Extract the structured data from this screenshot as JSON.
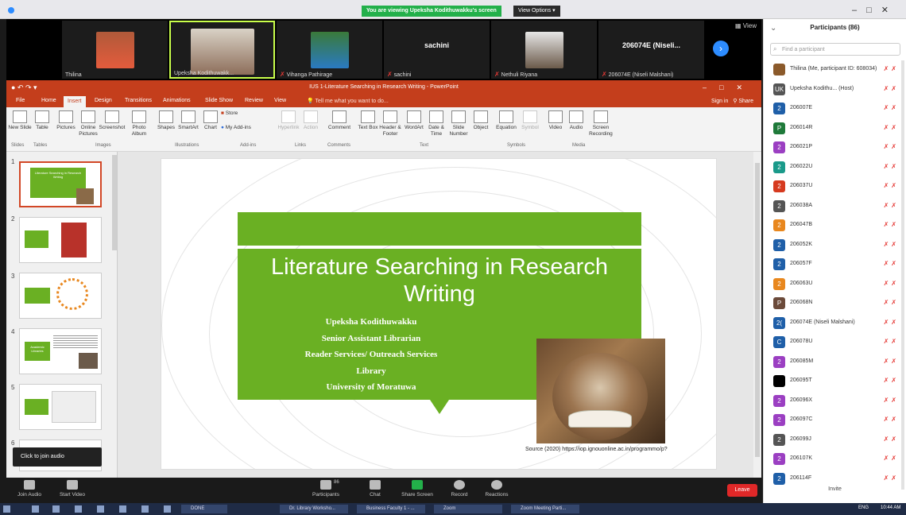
{
  "window": {
    "sharing_banner": "You are viewing Upeksha Kodithuwakku's screen",
    "view_options": "View Options"
  },
  "video": {
    "view_label": "View",
    "tiles": [
      {
        "name": "Thilina",
        "type": "video",
        "mic_muted": false
      },
      {
        "name": "Upeksha Kodithuwakk...",
        "type": "video",
        "mic_muted": false,
        "active_speaker": true
      },
      {
        "name": "Vihanga Pathirage",
        "type": "video",
        "mic_muted": true
      },
      {
        "name": "sachini",
        "center": "sachini",
        "type": "name",
        "mic_muted": true
      },
      {
        "name": "Nethuli Riyana",
        "type": "video",
        "mic_muted": true
      },
      {
        "name": "206074E (Niseli Malshani)",
        "center": "206074E (Niseli...",
        "type": "name",
        "mic_muted": true
      }
    ]
  },
  "ppt": {
    "doc_title": "IUS 1-Literature Searching in Research Writing - PowerPoint",
    "tell_me": "Tell me what you want to do...",
    "sign_in": "Sign in",
    "share": "Share",
    "menus": [
      "File",
      "Home",
      "Insert",
      "Design",
      "Transitions",
      "Animations",
      "Slide Show",
      "Review",
      "View"
    ],
    "active_menu": "Insert",
    "ribbon": {
      "buttons": [
        "New Slide",
        "Table",
        "Pictures",
        "Online Pictures",
        "Screenshot",
        "Photo Album",
        "Shapes",
        "SmartArt",
        "Chart",
        "Store",
        "My Add-ins",
        "Hyperlink",
        "Action",
        "Comment",
        "Text Box",
        "Header & Footer",
        "WordArt",
        "Date & Time",
        "Slide Number",
        "Object",
        "Equation",
        "Symbol",
        "Video",
        "Audio",
        "Screen Recording"
      ],
      "groups": [
        "Slides",
        "Tables",
        "Images",
        "Illustrations",
        "Add-ins",
        "Links",
        "Comments",
        "Text",
        "Symbols",
        "Media"
      ]
    },
    "thumb_numbers": [
      "1",
      "2",
      "3",
      "4",
      "5",
      "6"
    ],
    "thumb_titles": [
      "Literature Searching in Research Writing",
      "",
      "",
      "Academic Libraries",
      "",
      ""
    ],
    "tooltip": "Click to join audio",
    "slide": {
      "title": "Literature Searching in Research Writing",
      "author": "Upeksha Kodithuwakku",
      "role": "Senior Assistant Librarian",
      "dept": "Reader Services/ Outreach Services",
      "unit": "Library",
      "university": "University of Moratuwa",
      "source": "Source (2020) https://iop.ignouonline.ac.in/programmo/p?"
    }
  },
  "toolbar": {
    "join_audio": "Join Audio",
    "start_video": "Start Video",
    "participants": "Participants",
    "participants_count": "86",
    "chat": "Chat",
    "share_screen": "Share Screen",
    "record": "Record",
    "reactions": "Reactions",
    "leave": "Leave"
  },
  "participants_panel": {
    "header": "Participants (86)",
    "search_placeholder": "Find a participant",
    "invite": "Invite",
    "list": [
      {
        "avatar": "",
        "name": "Thilina (Me, participant ID: 608034)",
        "color": "#8b5a2b"
      },
      {
        "avatar": "UK",
        "name": "Upeksha Kodithu... (Host)",
        "color": "#555555"
      },
      {
        "avatar": "2",
        "name": "206007E",
        "color": "#1f5fa8"
      },
      {
        "avatar": "P",
        "name": "206014R",
        "color": "#1f7a3a"
      },
      {
        "avatar": "2",
        "name": "206021P",
        "color": "#9b3fc2"
      },
      {
        "avatar": "2",
        "name": "206022U",
        "color": "#1a9a8a"
      },
      {
        "avatar": "2",
        "name": "206037U",
        "color": "#d63a1f"
      },
      {
        "avatar": "2",
        "name": "206038A",
        "color": "#555555"
      },
      {
        "avatar": "2",
        "name": "206047B",
        "color": "#e8871e"
      },
      {
        "avatar": "2",
        "name": "206052K",
        "color": "#1f5fa8"
      },
      {
        "avatar": "2",
        "name": "206057F",
        "color": "#1f5fa8"
      },
      {
        "avatar": "2",
        "name": "206063U",
        "color": "#e8871e"
      },
      {
        "avatar": "P",
        "name": "206068N",
        "color": "#6b4a3a"
      },
      {
        "avatar": "2(",
        "name": "206074E (Niseli Malshani)",
        "color": "#1f5fa8"
      },
      {
        "avatar": "C",
        "name": "206078U",
        "color": "#1f5fa8"
      },
      {
        "avatar": "2",
        "name": "206085M",
        "color": "#9b3fc2"
      },
      {
        "avatar": "",
        "name": "206095T",
        "color": "#000000"
      },
      {
        "avatar": "2",
        "name": "206096X",
        "color": "#9b3fc2"
      },
      {
        "avatar": "2",
        "name": "206097C",
        "color": "#9b3fc2"
      },
      {
        "avatar": "2",
        "name": "206099J",
        "color": "#555555"
      },
      {
        "avatar": "2",
        "name": "206107K",
        "color": "#9b3fc2"
      },
      {
        "avatar": "2",
        "name": "206114F",
        "color": "#1f5fa8"
      }
    ]
  },
  "taskbar": {
    "apps": [
      "DONE",
      "Dr. Library Worksho...",
      "Business Faculty 1 - ...",
      "Zoom",
      "Zoom Meeting Parti..."
    ],
    "lang": "ENG",
    "time": "10:44 AM"
  },
  "colors": {
    "ppt_accent": "#c43e1c",
    "slide_green": "#6ab023",
    "zoom_blue": "#2d8cff",
    "leave_red": "#e02828"
  }
}
